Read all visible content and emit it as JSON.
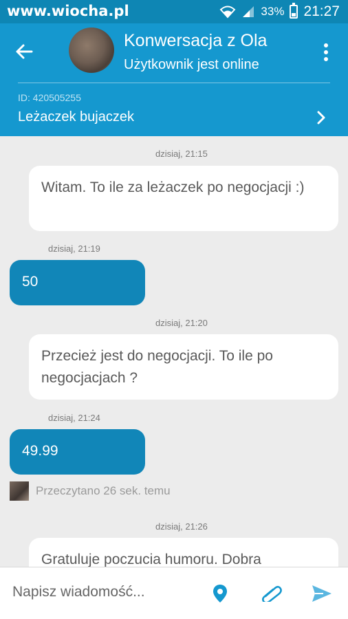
{
  "watermark": "www.wiocha.pl",
  "status_bar": {
    "battery": "33%",
    "time": "21:27"
  },
  "header": {
    "title": "Konwersacja z Ola",
    "subtitle": "Użytkownik jest online",
    "item_id": "ID: 420505255",
    "item_name": "Leżaczek bujaczek"
  },
  "messages": [
    {
      "time": "dzisiaj, 21:15",
      "side": "incoming",
      "text": "Witam. To ile za leżaczek po negocjacji :)"
    },
    {
      "time": "dzisiaj, 21:19",
      "side": "outgoing",
      "text": "50"
    },
    {
      "time": "dzisiaj, 21:20",
      "side": "incoming",
      "text": "Przecież jest do negocjacji. To ile po negocjacjach ?"
    },
    {
      "time": "dzisiaj, 21:24",
      "side": "outgoing",
      "text": "49.99"
    },
    {
      "time": "dzisiaj, 21:26",
      "side": "incoming",
      "text": "Gratuluje poczucia humoru. Dobra"
    }
  ],
  "read_receipt": "Przeczytano 26 sek. temu",
  "composer": {
    "placeholder": "Napisz wiadomość..."
  },
  "colors": {
    "status_bar": "#0e86b4",
    "header": "#1598cf",
    "outgoing_bubble": "#1186b8",
    "incoming_bubble": "#ffffff",
    "background": "#ececec"
  },
  "icons": [
    "back-arrow-icon",
    "more-vert-icon",
    "chevron-right-icon",
    "location-pin-icon",
    "paperclip-icon",
    "send-icon",
    "wifi-icon",
    "signal-icon",
    "battery-icon"
  ]
}
